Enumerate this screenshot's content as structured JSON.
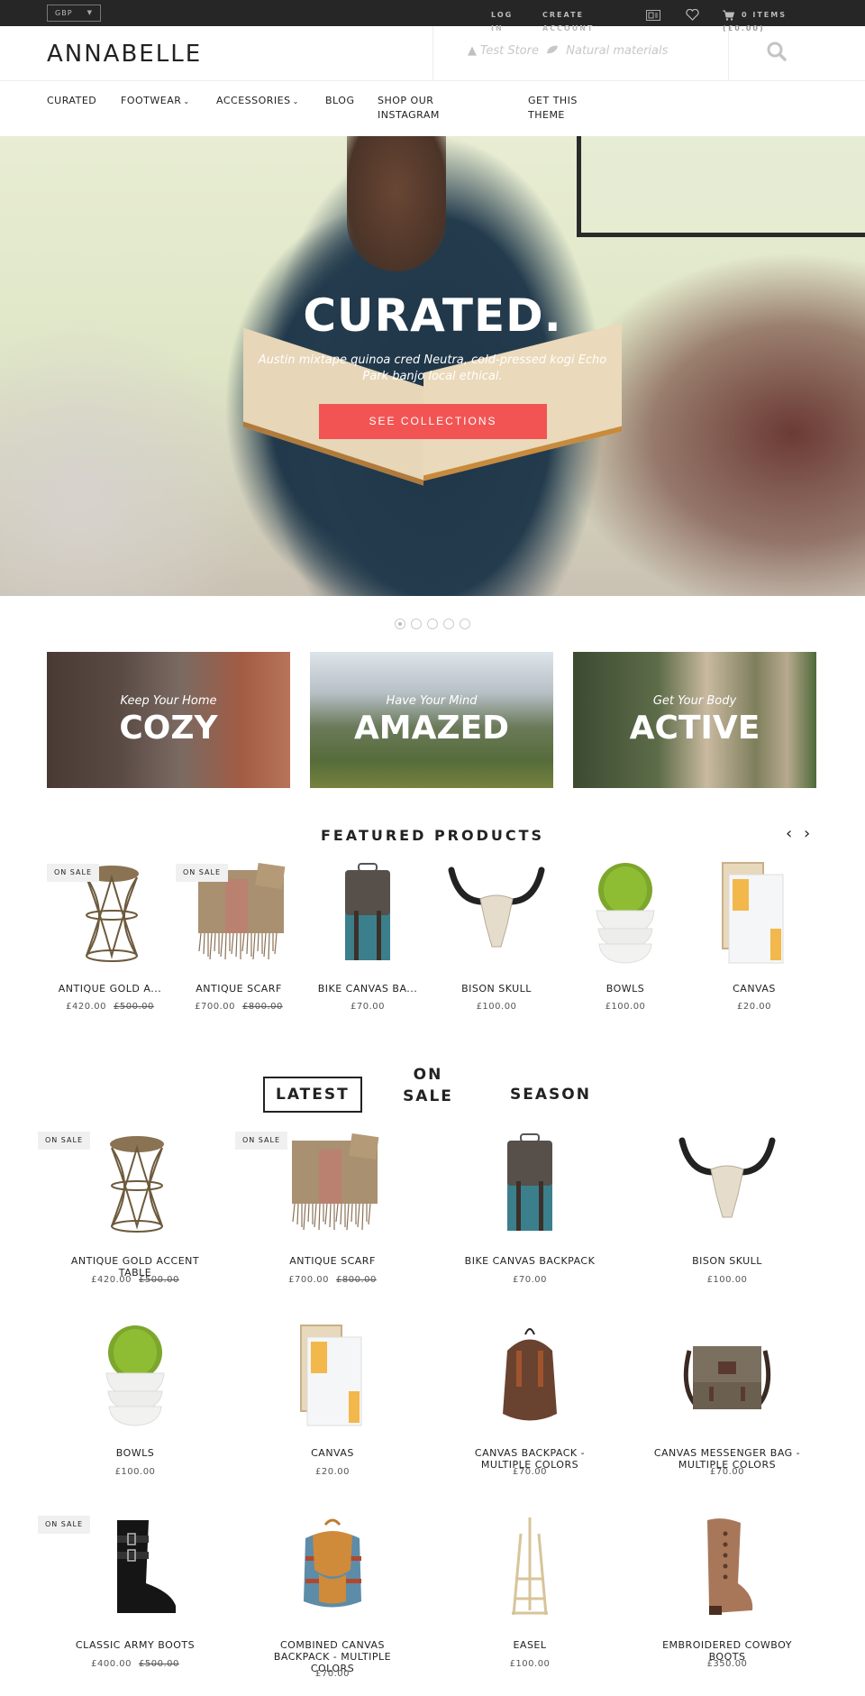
{
  "topbar": {
    "currency": "GBP",
    "log_in": "LOG IN",
    "create_account": "CREATE ACCOUNT",
    "cart_label": "0 ITEMS",
    "cart_total": "(£0.00)"
  },
  "header": {
    "logo": "ANNABELLE",
    "tagline_1": "Test Store",
    "tagline_2": "Natural materials"
  },
  "nav": {
    "items": [
      {
        "label": "CURATED"
      },
      {
        "label": "FOOTWEAR",
        "has_dropdown": true
      },
      {
        "label": "ACCESSORIES",
        "has_dropdown": true
      },
      {
        "label": "BLOG"
      },
      {
        "label": "SHOP OUR INSTAGRAM"
      },
      {
        "label": "GET THIS THEME"
      }
    ]
  },
  "hero": {
    "title": "CURATED.",
    "subtitle": "Austin mixtape quinoa cred Neutra, cold-pressed kogi Echo Park banjo local ethical.",
    "button": "SEE COLLECTIONS",
    "slide_count": 5,
    "active_slide": 1,
    "accent_color": "#f25454"
  },
  "collections": [
    {
      "sub": "Keep Your Home",
      "main": "COZY"
    },
    {
      "sub": "Have Your Mind",
      "main": "AMAZED"
    },
    {
      "sub": "Get Your Body",
      "main": "ACTIVE"
    }
  ],
  "featured": {
    "title": "FEATURED PRODUCTS",
    "products": [
      {
        "name": "ANTIQUE GOLD A...",
        "price": "£420.00",
        "old_price": "£500.00",
        "badge": "ON SALE"
      },
      {
        "name": "ANTIQUE SCARF",
        "price": "£700.00",
        "old_price": "£800.00",
        "badge": "ON SALE"
      },
      {
        "name": "BIKE CANVAS BA...",
        "price": "£70.00"
      },
      {
        "name": "BISON SKULL",
        "price": "£100.00"
      },
      {
        "name": "BOWLS",
        "price": "£100.00"
      },
      {
        "name": "CANVAS",
        "price": "£20.00"
      }
    ]
  },
  "tabs": {
    "latest": "LATEST",
    "on_sale": "ON SALE",
    "season": "SEASON"
  },
  "badge_text": "ON SALE",
  "products": [
    {
      "name": "ANTIQUE GOLD ACCENT TABLE",
      "price": "£420.00",
      "old_price": "£500.00",
      "badge": "ON SALE"
    },
    {
      "name": "ANTIQUE SCARF",
      "price": "£700.00",
      "old_price": "£800.00",
      "badge": "ON SALE"
    },
    {
      "name": "BIKE CANVAS BACKPACK",
      "price": "£70.00"
    },
    {
      "name": "BISON SKULL",
      "price": "£100.00"
    },
    {
      "name": "BOWLS",
      "price": "£100.00"
    },
    {
      "name": "CANVAS",
      "price": "£20.00"
    },
    {
      "name": "CANVAS BACKPACK - MULTIPLE COLORS",
      "price": "£70.00"
    },
    {
      "name": "CANVAS MESSENGER BAG - MULTIPLE COLORS",
      "price": "£70.00"
    },
    {
      "name": "CLASSIC ARMY BOOTS",
      "price": "£400.00",
      "old_price": "£500.00",
      "badge": "ON SALE"
    },
    {
      "name": "COMBINED CANVAS BACKPACK - MULTIPLE COLORS",
      "price": "£70.00"
    },
    {
      "name": "EASEL",
      "price": "£100.00"
    },
    {
      "name": "EMBROIDERED COWBOY BOOTS",
      "price": "£350.00"
    }
  ]
}
